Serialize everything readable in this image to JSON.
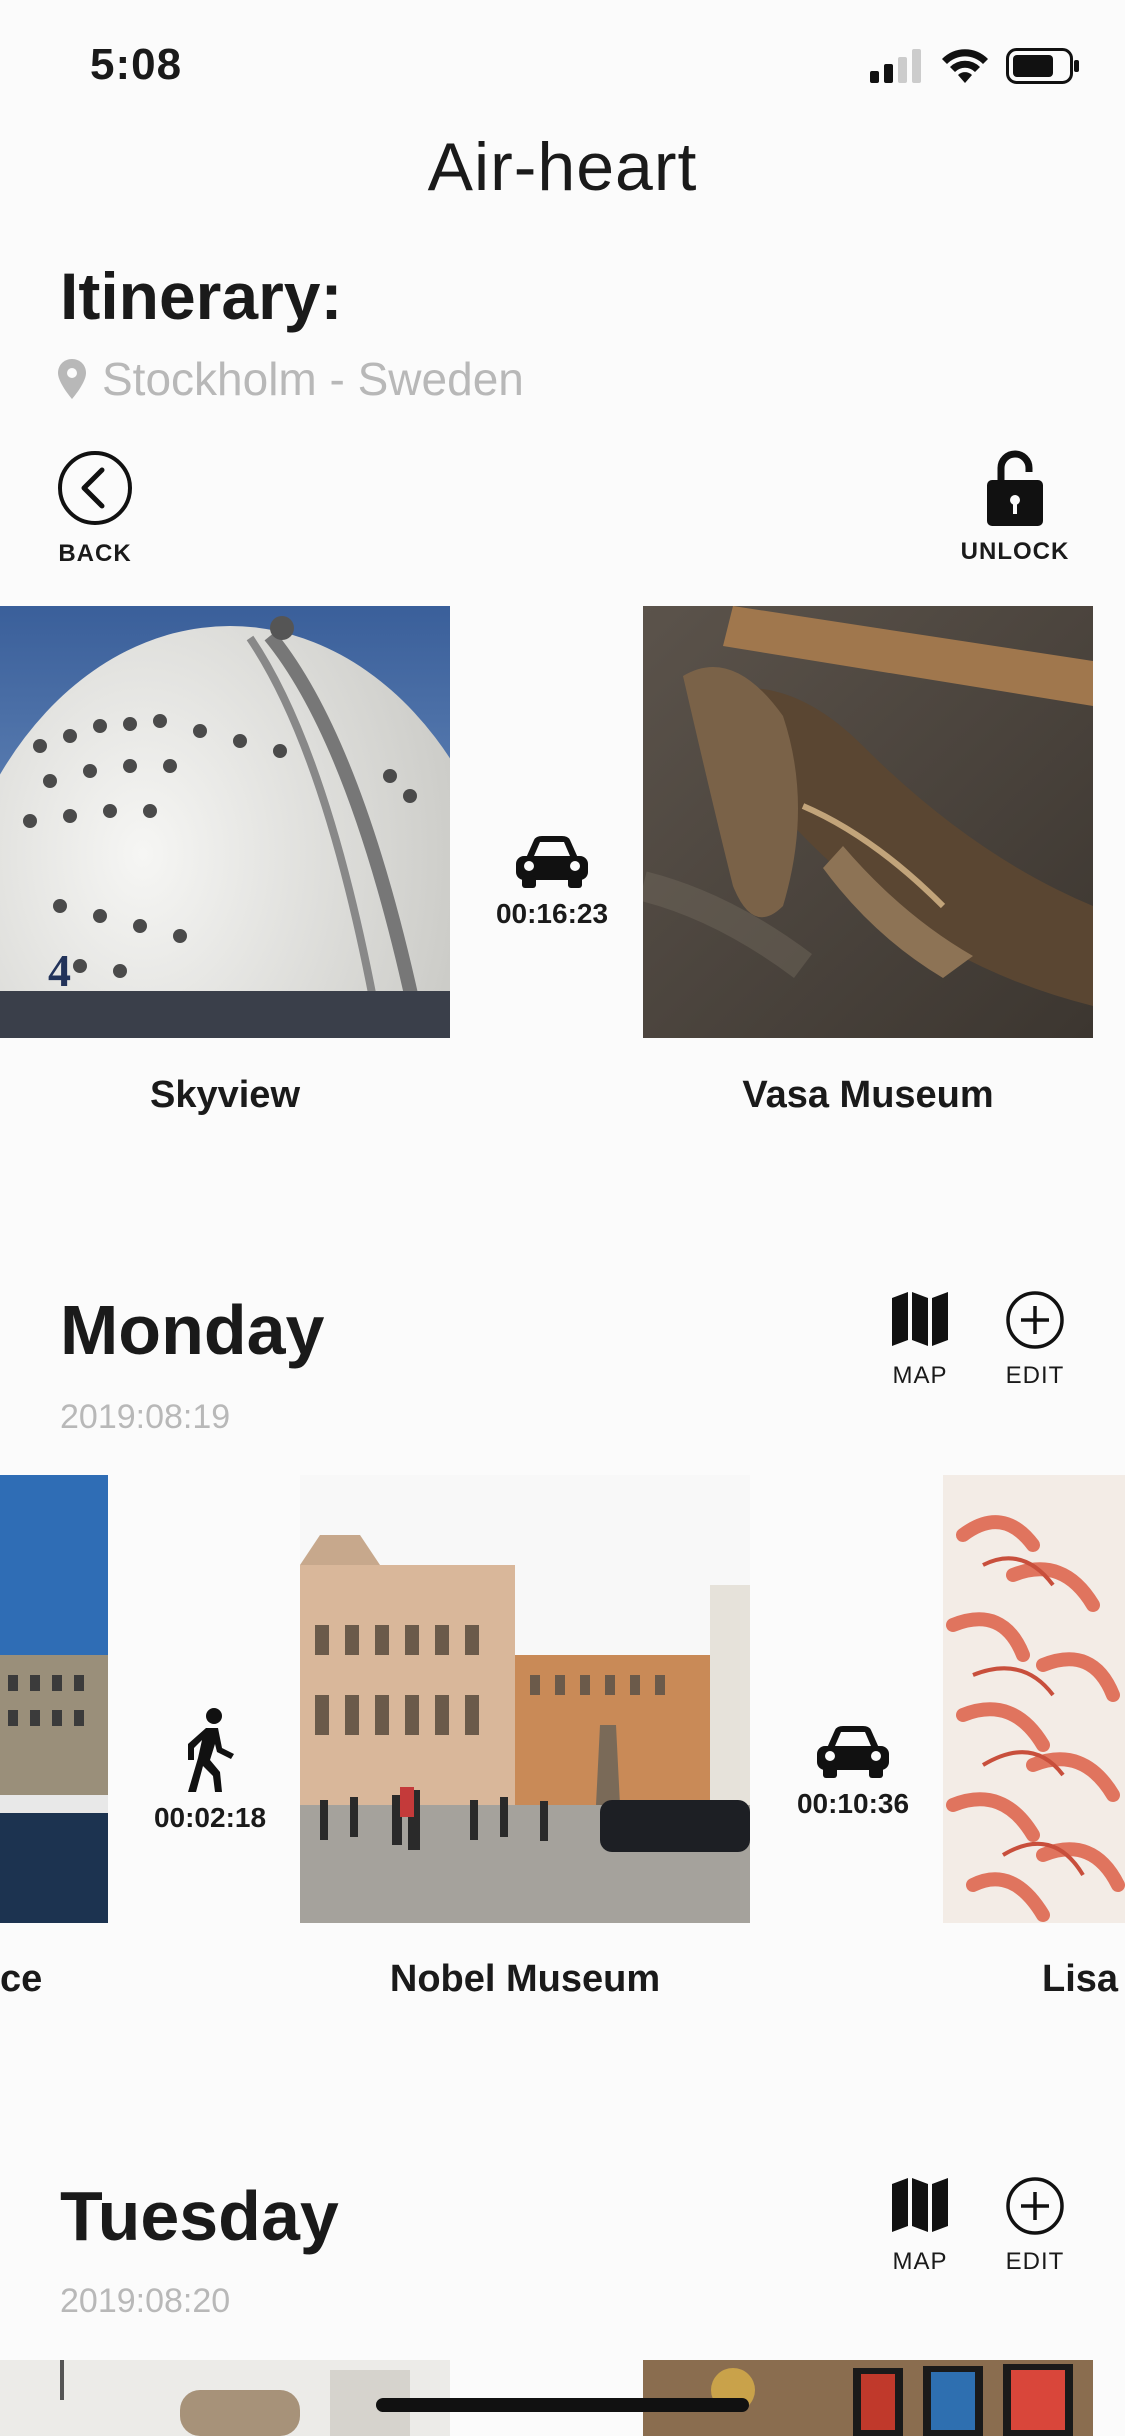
{
  "status_bar": {
    "time": "5:08"
  },
  "app": {
    "title": "Air-heart"
  },
  "itinerary": {
    "heading": "Itinerary:",
    "location": "Stockholm - Sweden",
    "back_label": "BACK",
    "unlock_label": "UNLOCK"
  },
  "top_row": {
    "items": [
      {
        "caption": "Skyview"
      },
      {
        "caption": "Vasa Museum"
      }
    ],
    "transits": [
      {
        "mode": "car-icon",
        "time": "00:16:23"
      }
    ]
  },
  "days": [
    {
      "name": "Monday",
      "date": "2019:08:19",
      "map_label": "MAP",
      "edit_label": "EDIT",
      "items": [
        {
          "caption": "ce"
        },
        {
          "caption": "Nobel Museum"
        },
        {
          "caption": "Lisa"
        }
      ],
      "transits": [
        {
          "mode": "walk-icon",
          "time": "00:02:18"
        },
        {
          "mode": "car-icon",
          "time": "00:10:36"
        }
      ]
    },
    {
      "name": "Tuesday",
      "date": "2019:08:20",
      "map_label": "MAP",
      "edit_label": "EDIT"
    }
  ]
}
